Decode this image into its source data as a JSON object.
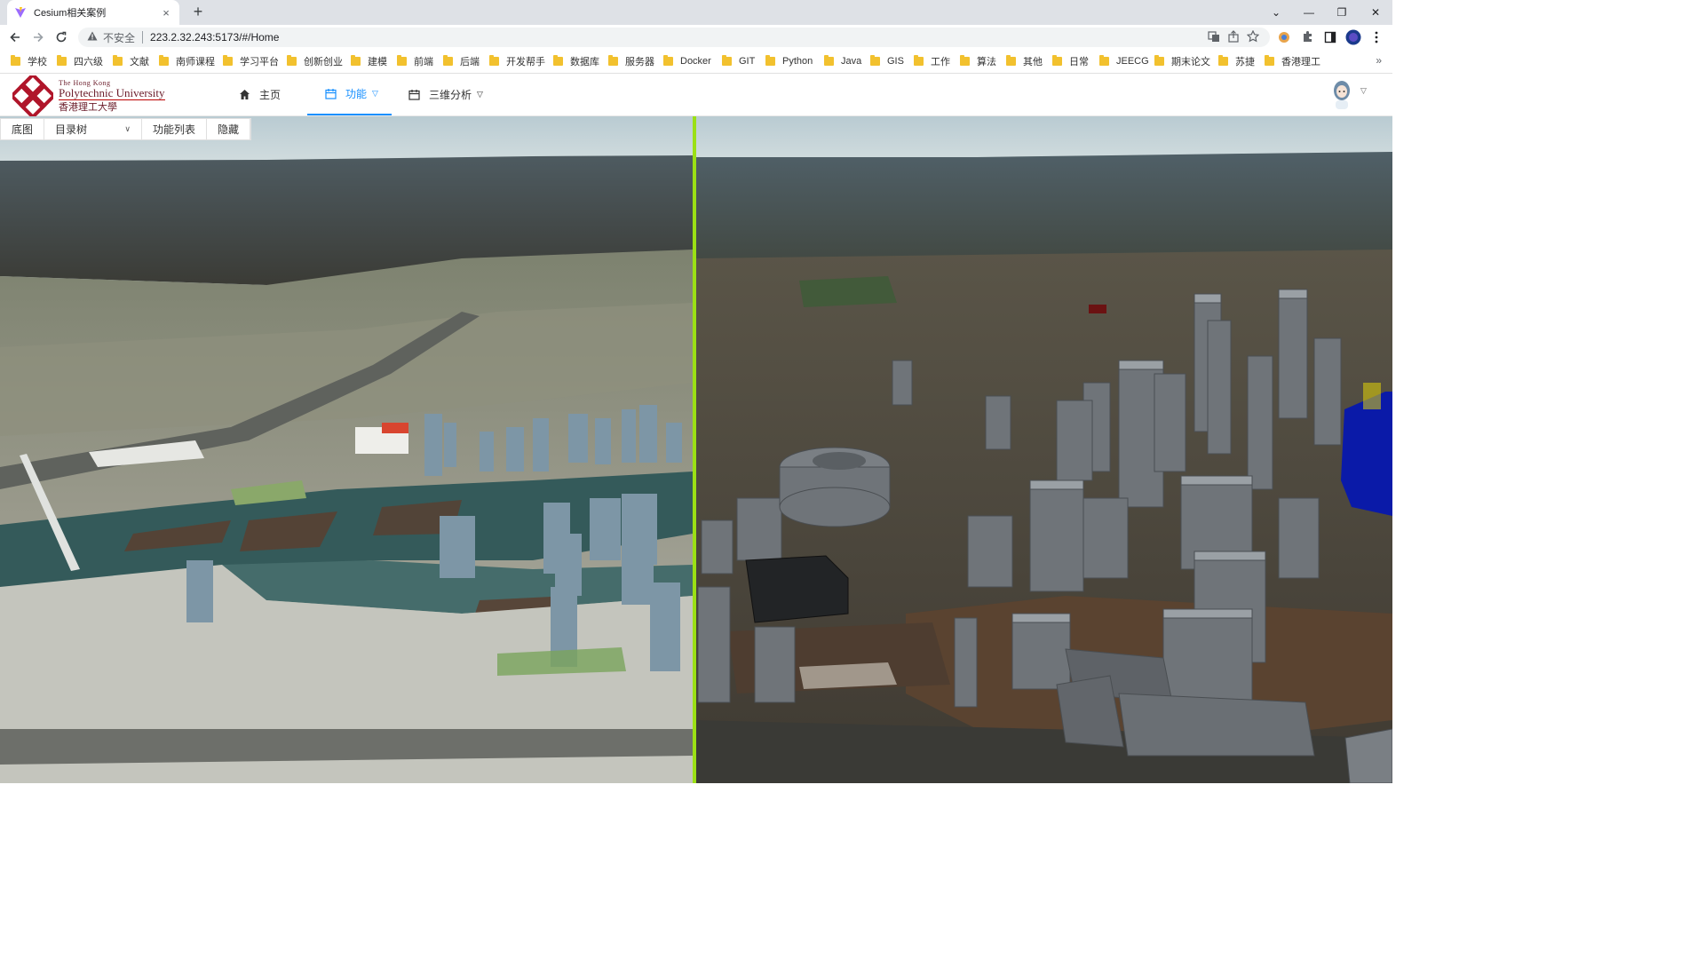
{
  "browser": {
    "tab_title": "Cesium相关案例",
    "new_tab": "+",
    "close_tab": "×",
    "not_secure": "不安全",
    "url": "223.2.32.243:5173/#/Home",
    "bookmarks": [
      "学校",
      "四六级",
      "文献",
      "南师课程",
      "学习平台",
      "创新创业",
      "建模",
      "前端",
      "后端",
      "开发帮手",
      "数据库",
      "服务器",
      "Docker",
      "GIT",
      "Python",
      "Java",
      "GIS",
      "工作",
      "算法",
      "其他",
      "日常",
      "JEECG",
      "期末论文",
      "苏捷",
      "香港理工"
    ],
    "more": "»",
    "win_min": "—",
    "win_max": "❐",
    "win_close": "✕",
    "win_down": "⌄"
  },
  "app": {
    "logo": {
      "line1": "The Hong Kong",
      "line2": "Polytechnic University",
      "line3": "香港理工大學"
    },
    "menu": {
      "home": "主页",
      "features": "功能",
      "analysis": "三维分析"
    }
  },
  "toolbar": {
    "basemap": "底图",
    "catalog": "目录树",
    "function_list": "功能列表",
    "hide": "隐藏"
  },
  "colors": {
    "accent": "#1890ff",
    "split_line": "#9be015",
    "highlight_building": "#0a1aa8"
  },
  "icons": [
    "warning-icon",
    "home-icon",
    "calendar-icon",
    "chevron-down-icon",
    "avatar-icon"
  ]
}
